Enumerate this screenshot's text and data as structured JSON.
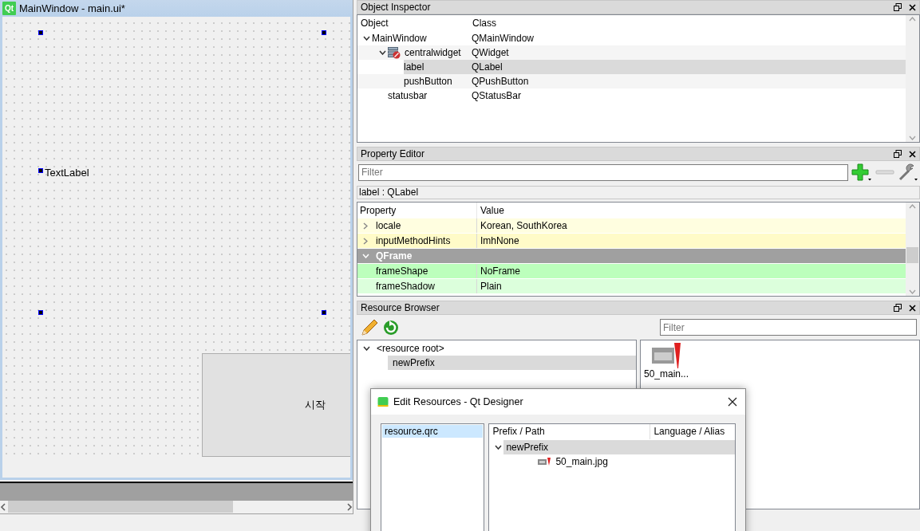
{
  "form_window": {
    "logo": "Qt",
    "title": "MainWindow - main.ui*",
    "label_text": "TextLabel",
    "push_button": "시작"
  },
  "object_inspector": {
    "title": "Object Inspector",
    "columns": [
      "Object",
      "Class"
    ],
    "tree": [
      {
        "object": "MainWindow",
        "class": "QMainWindow",
        "expanded": true,
        "selected": false,
        "children": [
          {
            "object": "centralwidget",
            "class": "QWidget",
            "expanded": true,
            "selected": false,
            "children": [
              {
                "object": "label",
                "class": "QLabel",
                "selected": true
              },
              {
                "object": "pushButton",
                "class": "QPushButton",
                "selected": false
              }
            ]
          },
          {
            "object": "statusbar",
            "class": "QStatusBar",
            "selected": false
          }
        ]
      }
    ]
  },
  "property_editor": {
    "title": "Property Editor",
    "filter_placeholder": "Filter",
    "object_label": "label : QLabel",
    "columns": [
      "Property",
      "Value"
    ],
    "rows": [
      {
        "kind": "property",
        "name": "locale",
        "value": "Korean, SouthKorea",
        "expanded": false,
        "color": "#fffee0"
      },
      {
        "kind": "property",
        "name": "inputMethodHints",
        "value": "ImhNone",
        "expanded": false,
        "color": "#fffbc8"
      },
      {
        "kind": "section",
        "name": "QFrame",
        "expanded": true,
        "color": "#a0a0a0"
      },
      {
        "kind": "property",
        "name": "frameShape",
        "value": "NoFrame",
        "color": "#bcffbc"
      },
      {
        "kind": "property",
        "name": "frameShadow",
        "value": "Plain",
        "color": "#dcffdc"
      }
    ]
  },
  "resource_browser": {
    "title": "Resource Browser",
    "filter_placeholder": "Filter",
    "tree": [
      {
        "name": "<resource root>",
        "expanded": true,
        "selected": false,
        "children": [
          {
            "name": "newPrefix",
            "selected": true
          }
        ]
      }
    ],
    "files": [
      {
        "name": "50_main..."
      }
    ]
  },
  "edit_resources_dialog": {
    "title": "Edit Resources - Qt Designer",
    "files": [
      {
        "name": "resource.qrc",
        "selected": true
      }
    ],
    "columns": [
      "Prefix / Path",
      "Language / Alias"
    ],
    "tree": [
      {
        "path": "newPrefix",
        "expanded": true,
        "selected": true,
        "children": [
          {
            "path": "50_main.jpg",
            "selected": false
          }
        ]
      }
    ]
  }
}
